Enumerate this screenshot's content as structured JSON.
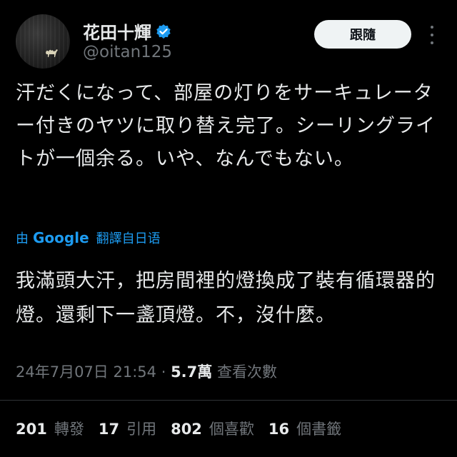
{
  "author": {
    "name": "花田十輝",
    "handle": "@oitan125",
    "verified_color": "#1d9bf0"
  },
  "follow_label": "跟隨",
  "tweet": {
    "text": "汗だくになって、部屋の灯りをサーキュレーター付きのヤツに取り替え完了。シーリングライトが一個余る。いや、なんでもない。"
  },
  "translation": {
    "by": "由",
    "provider": "Google",
    "label": "翻譯自日语",
    "text": "我滿頭大汗，把房間裡的燈換成了裝有循環器的燈。還剩下一盞頂燈。不，沒什麼。"
  },
  "meta": {
    "timestamp": "24年7月07日 21:54",
    "separator": "·",
    "views": "5.7萬",
    "views_label": "查看次數"
  },
  "stats": {
    "reposts": {
      "count": "201",
      "label": "轉發"
    },
    "quotes": {
      "count": "17",
      "label": "引用"
    },
    "likes": {
      "count": "802",
      "label": "個喜歡"
    },
    "bookmarks": {
      "count": "16",
      "label": "個書籤"
    }
  },
  "icons": {
    "verified": "verified-badge-icon",
    "more": "more-options-icon"
  }
}
